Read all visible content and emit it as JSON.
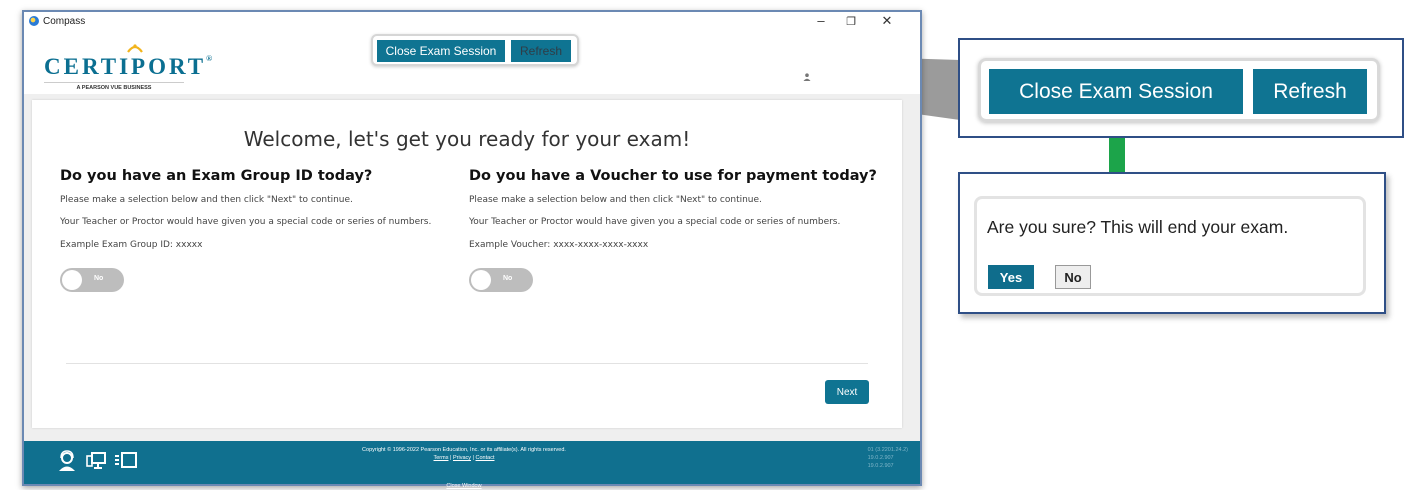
{
  "window": {
    "title": "Compass",
    "minimize": "–",
    "maximize": "❐",
    "close": "✕"
  },
  "header": {
    "logo_word": "CERTIPORT",
    "logo_tm": "®",
    "logo_sub": "A PEARSON VUE BUSINESS",
    "close_exam_label": "Close Exam Session",
    "refresh_label": "Refresh"
  },
  "main": {
    "welcome": "Welcome, let's get you ready for your exam!",
    "left": {
      "title": "Do you have an Exam Group ID today?",
      "line1": "Please make a selection below and then click \"Next\" to continue.",
      "line2": "Your Teacher or Proctor would have given you a special code or series of numbers.",
      "line3": "Example Exam Group ID: xxxxx",
      "toggle_label": "No"
    },
    "right": {
      "title": "Do you have a Voucher to use for payment today?",
      "line1": "Please make a selection below and then click \"Next\" to continue.",
      "line2": "Your Teacher or Proctor would have given you a special code or series of numbers.",
      "line3": "Example Voucher: xxxx-xxxx-xxxx-xxxx",
      "toggle_label": "No"
    },
    "next_label": "Next"
  },
  "footer": {
    "copyright": "Copyright © 1996-2022 Pearson Education, Inc. or its affiliate(s). All rights reserved.",
    "terms": "Terms",
    "sep1": "|",
    "privacy": "Privacy",
    "sep2": "|",
    "contact": "Contact",
    "close_window": "Close Window",
    "version_1": "01 (3.2201.24.2)",
    "version_2": "19.0.2.907",
    "version_3": "19.0.2.907"
  },
  "callout_buttons": {
    "close_exam_label": "Close Exam Session",
    "refresh_label": "Refresh"
  },
  "callout_confirm": {
    "message": "Are you sure? This will end your exam.",
    "yes_label": "Yes",
    "no_label": "No"
  },
  "colors": {
    "teal": "#0f7492",
    "footer": "#10708f",
    "callout_border": "#2f4f86",
    "connector_green": "#1ca44a"
  }
}
